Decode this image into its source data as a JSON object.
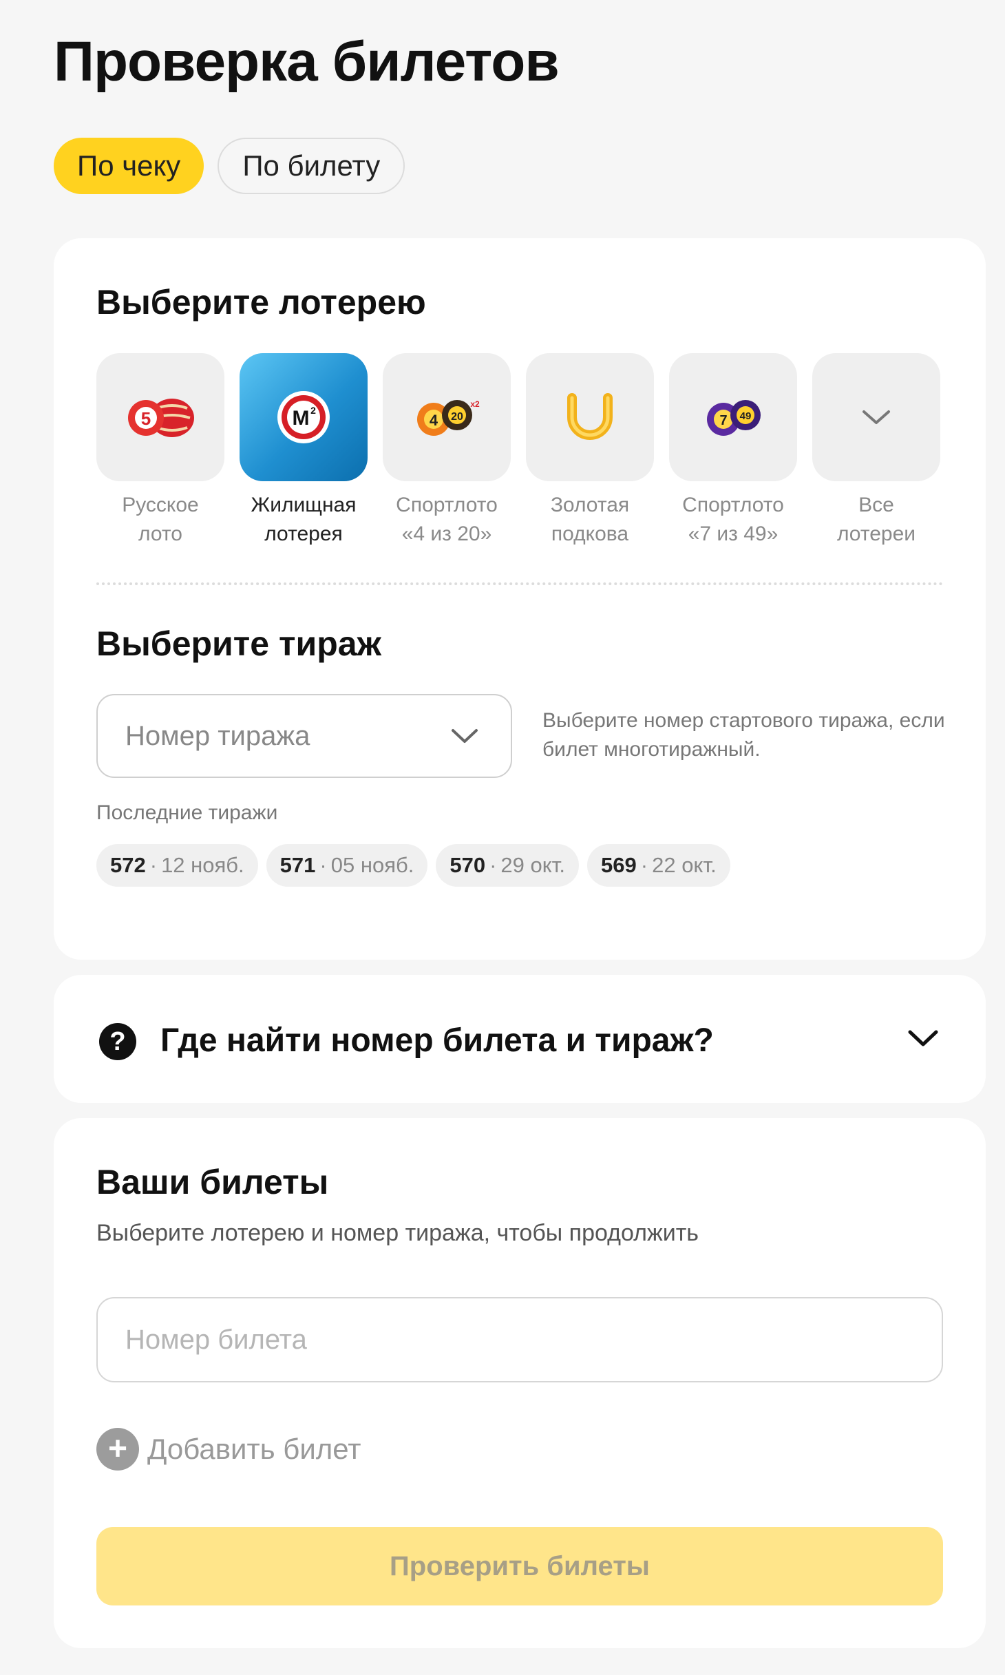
{
  "page": {
    "title": "Проверка билетов"
  },
  "tabs": [
    {
      "label": "По чеку",
      "active": true
    },
    {
      "label": "По билету",
      "active": false
    }
  ],
  "lottery_section": {
    "title": "Выберите лотерею",
    "items": [
      {
        "label": "Русское\nлото",
        "icon": "russian-loto-barrels-icon",
        "selected": false
      },
      {
        "label": "Жилищная\nлотерея",
        "icon": "m2-housing-icon",
        "selected": true
      },
      {
        "label": "Спортлото\n«4 из 20»",
        "icon": "sportloto-4-20-balls-icon",
        "selected": false
      },
      {
        "label": "Золотая\nподкова",
        "icon": "golden-horseshoe-icon",
        "selected": false
      },
      {
        "label": "Спортлото\n«7 из 49»",
        "icon": "sportloto-7-49-balls-icon",
        "selected": false
      },
      {
        "label": "Все\nлотереи",
        "icon": "chevron-down-icon",
        "selected": false
      }
    ]
  },
  "draw_section": {
    "title": "Выберите тираж",
    "select_placeholder": "Номер тиража",
    "hint": "Выберите номер стартового тиража, если билет многотиражный.",
    "recent_label": "Последние тиражи",
    "recent": [
      {
        "number": "572",
        "date": "12 нояб."
      },
      {
        "number": "571",
        "date": "05 нояб."
      },
      {
        "number": "570",
        "date": "29 окт."
      },
      {
        "number": "569",
        "date": "22 окт."
      }
    ]
  },
  "faq": {
    "title": "Где найти номер билета и тираж?",
    "icon": "question-icon"
  },
  "tickets": {
    "title": "Ваши билеты",
    "subtitle": "Выберите лотерею и номер тиража, чтобы продолжить",
    "input_placeholder": "Номер билета",
    "add_label": "Добавить билет",
    "submit_label": "Проверить билеты"
  },
  "colors": {
    "accent": "#ffd21f",
    "accent_disabled": "#ffe58a",
    "background": "#f6f6f6",
    "card": "#ffffff"
  }
}
